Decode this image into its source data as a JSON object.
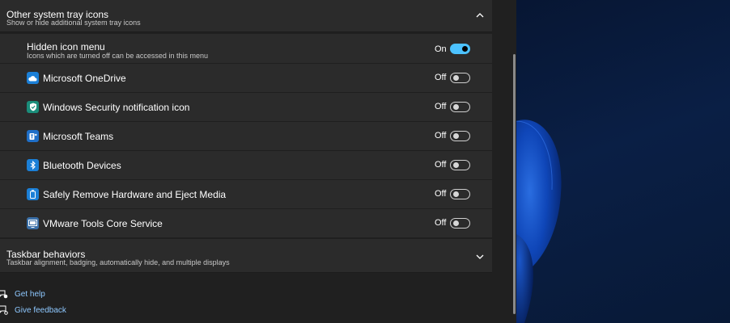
{
  "tray_section": {
    "title": "Other system tray icons",
    "subtitle": "Show or hide additional system tray icons"
  },
  "hidden_menu": {
    "title": "Hidden icon menu",
    "subtitle": "Icons which are turned off can be accessed in this menu",
    "state": "On",
    "on": true
  },
  "apps": [
    {
      "label": "Microsoft OneDrive",
      "state": "Off",
      "icon": "cloud-icon"
    },
    {
      "label": "Windows Security notification icon",
      "state": "Off",
      "icon": "shield-icon"
    },
    {
      "label": "Microsoft Teams",
      "state": "Off",
      "icon": "teams-icon"
    },
    {
      "label": "Bluetooth Devices",
      "state": "Off",
      "icon": "bluetooth-icon"
    },
    {
      "label": "Safely Remove Hardware and Eject Media",
      "state": "Off",
      "icon": "usb-drive-icon"
    },
    {
      "label": "VMware Tools Core Service",
      "state": "Off",
      "icon": "vmware-icon"
    }
  ],
  "behaviors_section": {
    "title": "Taskbar behaviors",
    "subtitle": "Taskbar alignment, badging, automatically hide, and multiple displays"
  },
  "links": {
    "help": "Get help",
    "feedback": "Give feedback"
  },
  "colors": {
    "accent": "#4cc2ff",
    "link": "#8ec8ff",
    "card": "#2b2b2b",
    "background": "#202020",
    "app_icon": "#1b7fd6"
  }
}
